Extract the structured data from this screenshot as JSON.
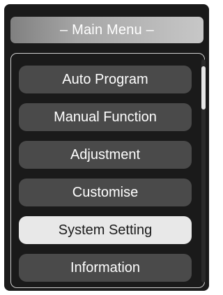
{
  "title": "– Main Menu –",
  "menu": {
    "items": [
      {
        "label": "Auto Program",
        "selected": false
      },
      {
        "label": "Manual Function",
        "selected": false
      },
      {
        "label": "Adjustment",
        "selected": false
      },
      {
        "label": "Customise",
        "selected": false
      },
      {
        "label": "System Setting",
        "selected": true
      },
      {
        "label": "Information",
        "selected": false
      }
    ]
  },
  "colors": {
    "background": "#1a1a1a",
    "item": "#4a4a4a",
    "item_selected": "#e8e8e8",
    "text": "#ffffff",
    "text_selected": "#1a1a1a"
  }
}
